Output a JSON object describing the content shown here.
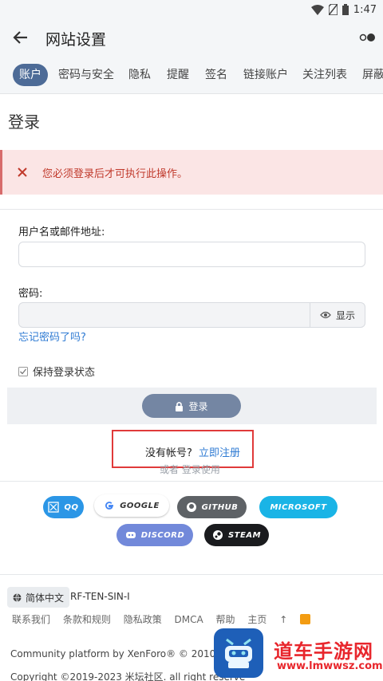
{
  "status_bar": {
    "time": "1:47"
  },
  "header": {
    "title": "网站设置"
  },
  "tabs": [
    {
      "label": "账户"
    },
    {
      "label": "密码与安全"
    },
    {
      "label": "隐私"
    },
    {
      "label": "提醒"
    },
    {
      "label": "签名"
    },
    {
      "label": "链接账户"
    },
    {
      "label": "关注列表"
    },
    {
      "label": "屏蔽"
    }
  ],
  "page": {
    "title": "登录"
  },
  "error": {
    "message": "您必须登录后才可执行此操作。"
  },
  "form": {
    "username_label": "用户名或邮件地址:",
    "username_value": "",
    "password_label": "密码:",
    "password_value": "",
    "show_label": "显示",
    "forgot_label": "忘记密码了吗?",
    "remember_label": "保持登录状态",
    "login_label": "登录"
  },
  "register": {
    "prompt": "没有帐号?",
    "link": "立即注册"
  },
  "alt_login": {
    "text": "或者 登录使用"
  },
  "social": [
    {
      "label": "QQ",
      "color": "#2b96e6"
    },
    {
      "label": "GOOGLE",
      "color": "#ffffff"
    },
    {
      "label": "GITHUB",
      "color": "#5e6266"
    },
    {
      "label": "MICROSOFT",
      "color": "#1ab4e6"
    },
    {
      "label": "DISCORD",
      "color": "#7289da"
    },
    {
      "label": "STEAM",
      "color": "#1a1b1e"
    }
  ],
  "footer": {
    "language": "简体中文",
    "style": "RF-TEN-SIN-I",
    "links": [
      "联系我们",
      "条款和规则",
      "隐私政策",
      "DMCA",
      "帮助",
      "主页"
    ],
    "copyright_1": "Community platform by XenForo® © 2010-2021",
    "copyright_2": "Copyright ©2019-2023 米坛社区. all right reserve"
  },
  "watermark": {
    "title": "道车手游网",
    "url": "www.lmwwsz.com"
  }
}
